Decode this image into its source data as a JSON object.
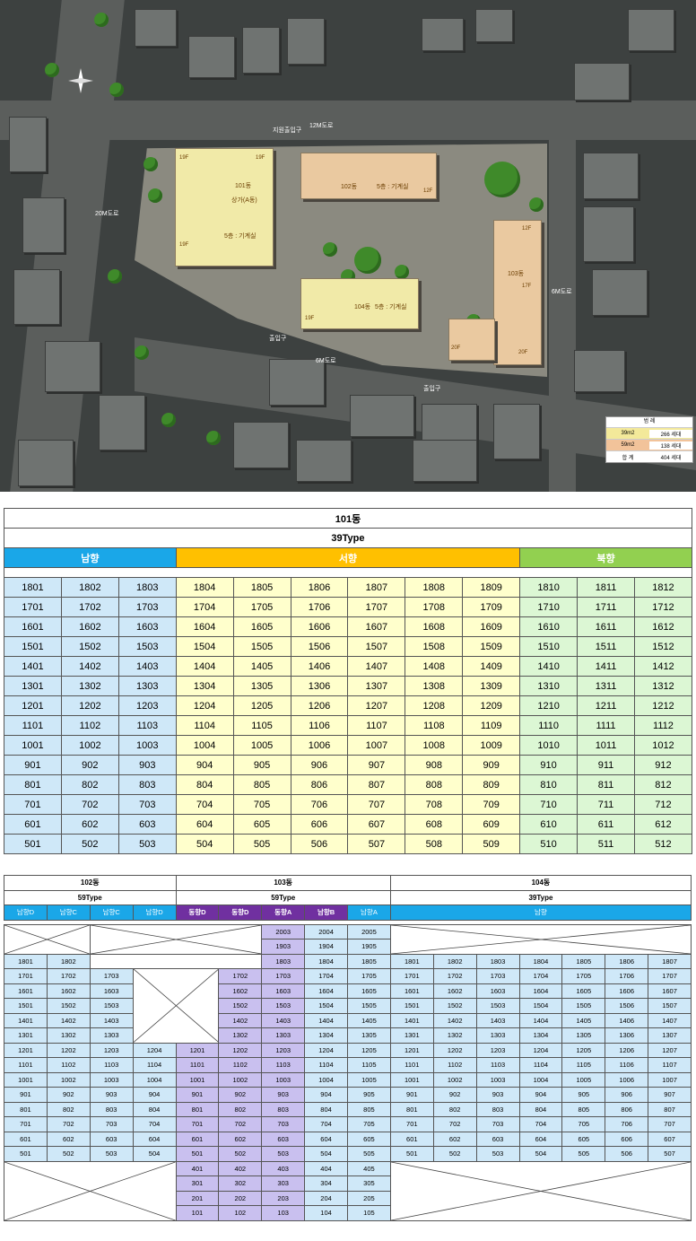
{
  "sitemap": {
    "labels": {
      "road_12m": "12M도로",
      "road_20m": "20M도로",
      "road_6m_east": "6M도로",
      "road_6m_south": "6M도로",
      "entrance_parking": "지원출입구",
      "entrance_1": "출입구",
      "entrance_2": "출입구",
      "bldg_101": "101동",
      "bldg_102": "102동",
      "bldg_103": "103동",
      "bldg_104": "104동",
      "shop": "상가(A동)",
      "floor_5_mech_101": "5층 : 기계실",
      "floor_5_mech_102": "5층 : 기계실",
      "floor_5_mech_104": "5층 : 기계실",
      "floor_19f": "19F",
      "floor_12f": "12F",
      "floor_17f": "17F",
      "floor_20f": "20F"
    },
    "legend": {
      "title": "범 례",
      "rows": [
        {
          "type": "39m2",
          "count": "266 세대",
          "color": "#f3e99a"
        },
        {
          "type": "59m2",
          "count": "138 세대",
          "color": "#f2c39a"
        }
      ],
      "total_label": "합 계",
      "total_count": "404 세대"
    }
  },
  "table101": {
    "title": "101동",
    "type": "39Type",
    "headers": [
      "남향",
      "서향",
      "북향"
    ],
    "header_colors": [
      "#1aa7e8",
      "#ffc000",
      "#92d050"
    ],
    "rows": [
      [
        "1801",
        "1802",
        "1803",
        "1804",
        "1805",
        "1806",
        "1807",
        "1808",
        "1809",
        "1810",
        "1811",
        "1812"
      ],
      [
        "1701",
        "1702",
        "1703",
        "1704",
        "1705",
        "1706",
        "1707",
        "1708",
        "1709",
        "1710",
        "1711",
        "1712"
      ],
      [
        "1601",
        "1602",
        "1603",
        "1604",
        "1605",
        "1606",
        "1607",
        "1608",
        "1609",
        "1610",
        "1611",
        "1612"
      ],
      [
        "1501",
        "1502",
        "1503",
        "1504",
        "1505",
        "1506",
        "1507",
        "1508",
        "1509",
        "1510",
        "1511",
        "1512"
      ],
      [
        "1401",
        "1402",
        "1403",
        "1404",
        "1405",
        "1406",
        "1407",
        "1408",
        "1409",
        "1410",
        "1411",
        "1412"
      ],
      [
        "1301",
        "1302",
        "1303",
        "1304",
        "1305",
        "1306",
        "1307",
        "1308",
        "1309",
        "1310",
        "1311",
        "1312"
      ],
      [
        "1201",
        "1202",
        "1203",
        "1204",
        "1205",
        "1206",
        "1207",
        "1208",
        "1209",
        "1210",
        "1211",
        "1212"
      ],
      [
        "1101",
        "1102",
        "1103",
        "1104",
        "1105",
        "1106",
        "1107",
        "1108",
        "1109",
        "1110",
        "1111",
        "1112"
      ],
      [
        "1001",
        "1002",
        "1003",
        "1004",
        "1005",
        "1006",
        "1007",
        "1008",
        "1009",
        "1010",
        "1011",
        "1012"
      ],
      [
        "901",
        "902",
        "903",
        "904",
        "905",
        "906",
        "907",
        "908",
        "909",
        "910",
        "911",
        "912"
      ],
      [
        "801",
        "802",
        "803",
        "804",
        "805",
        "806",
        "807",
        "808",
        "809",
        "810",
        "811",
        "812"
      ],
      [
        "701",
        "702",
        "703",
        "704",
        "705",
        "706",
        "707",
        "708",
        "709",
        "710",
        "711",
        "712"
      ],
      [
        "601",
        "602",
        "603",
        "604",
        "605",
        "606",
        "607",
        "608",
        "609",
        "610",
        "611",
        "612"
      ],
      [
        "501",
        "502",
        "503",
        "504",
        "505",
        "506",
        "507",
        "508",
        "509",
        "510",
        "511",
        "512"
      ]
    ]
  },
  "table2": {
    "bldg102": {
      "title": "102동",
      "type": "59Type"
    },
    "bldg103": {
      "title": "103동",
      "type": "59Type"
    },
    "bldg104": {
      "title": "104동",
      "type": "39Type"
    },
    "col_headers": [
      "남향D",
      "남향C",
      "남향C",
      "남향D",
      "동향D",
      "동향D",
      "동향A",
      "남향B",
      "남향A"
    ],
    "header_104": "남향",
    "rows": [
      {
        "c": [
          null,
          null,
          null,
          null,
          null,
          null,
          "2003",
          "2004",
          "2005"
        ],
        "r104": null
      },
      {
        "c": [
          null,
          null,
          null,
          null,
          null,
          null,
          "1903",
          "1904",
          "1905"
        ],
        "r104": null
      },
      {
        "c": [
          "1801",
          "1802",
          null,
          null,
          null,
          null,
          "1803",
          "1804",
          "1805"
        ],
        "r104": [
          "1801",
          "1802",
          "1803",
          "1804",
          "1805",
          "1806",
          "1807"
        ]
      },
      {
        "c": [
          "1701",
          "1702",
          "1703",
          null,
          null,
          "1702",
          "1703",
          "1704",
          "1705"
        ],
        "r104": [
          "1701",
          "1702",
          "1703",
          "1704",
          "1705",
          "1706",
          "1707"
        ]
      },
      {
        "c": [
          "1601",
          "1602",
          "1603",
          null,
          null,
          "1602",
          "1603",
          "1604",
          "1605"
        ],
        "r104": [
          "1601",
          "1602",
          "1603",
          "1604",
          "1605",
          "1606",
          "1607"
        ]
      },
      {
        "c": [
          "1501",
          "1502",
          "1503",
          null,
          null,
          "1502",
          "1503",
          "1504",
          "1505"
        ],
        "r104": [
          "1501",
          "1502",
          "1503",
          "1504",
          "1505",
          "1506",
          "1507"
        ]
      },
      {
        "c": [
          "1401",
          "1402",
          "1403",
          null,
          null,
          "1402",
          "1403",
          "1404",
          "1405"
        ],
        "r104": [
          "1401",
          "1402",
          "1403",
          "1404",
          "1405",
          "1406",
          "1407"
        ]
      },
      {
        "c": [
          "1301",
          "1302",
          "1303",
          null,
          null,
          "1302",
          "1303",
          "1304",
          "1305"
        ],
        "r104": [
          "1301",
          "1302",
          "1303",
          "1304",
          "1305",
          "1306",
          "1307"
        ]
      },
      {
        "c": [
          "1201",
          "1202",
          "1203",
          "1204",
          "1201",
          "1202",
          "1203",
          "1204",
          "1205"
        ],
        "r104": [
          "1201",
          "1202",
          "1203",
          "1204",
          "1205",
          "1206",
          "1207"
        ]
      },
      {
        "c": [
          "1101",
          "1102",
          "1103",
          "1104",
          "1101",
          "1102",
          "1103",
          "1104",
          "1105"
        ],
        "r104": [
          "1101",
          "1102",
          "1103",
          "1104",
          "1105",
          "1106",
          "1107"
        ]
      },
      {
        "c": [
          "1001",
          "1002",
          "1003",
          "1004",
          "1001",
          "1002",
          "1003",
          "1004",
          "1005"
        ],
        "r104": [
          "1001",
          "1002",
          "1003",
          "1004",
          "1005",
          "1006",
          "1007"
        ]
      },
      {
        "c": [
          "901",
          "902",
          "903",
          "904",
          "901",
          "902",
          "903",
          "904",
          "905"
        ],
        "r104": [
          "901",
          "902",
          "903",
          "904",
          "905",
          "906",
          "907"
        ]
      },
      {
        "c": [
          "801",
          "802",
          "803",
          "804",
          "801",
          "802",
          "803",
          "804",
          "805"
        ],
        "r104": [
          "801",
          "802",
          "803",
          "804",
          "805",
          "806",
          "807"
        ]
      },
      {
        "c": [
          "701",
          "702",
          "703",
          "704",
          "701",
          "702",
          "703",
          "704",
          "705"
        ],
        "r104": [
          "701",
          "702",
          "703",
          "704",
          "705",
          "706",
          "707"
        ]
      },
      {
        "c": [
          "601",
          "602",
          "603",
          "604",
          "601",
          "602",
          "603",
          "604",
          "605"
        ],
        "r104": [
          "601",
          "602",
          "603",
          "604",
          "605",
          "606",
          "607"
        ]
      },
      {
        "c": [
          "501",
          "502",
          "503",
          "504",
          "501",
          "502",
          "503",
          "504",
          "505"
        ],
        "r104": [
          "501",
          "502",
          "503",
          "504",
          "505",
          "506",
          "507"
        ]
      },
      {
        "c": [
          null,
          null,
          null,
          null,
          "401",
          "402",
          "403",
          "404",
          "405"
        ],
        "r104": null
      },
      {
        "c": [
          null,
          null,
          null,
          null,
          "301",
          "302",
          "303",
          "304",
          "305"
        ],
        "r104": null
      },
      {
        "c": [
          null,
          null,
          null,
          null,
          "201",
          "202",
          "203",
          "204",
          "205"
        ],
        "r104": null
      },
      {
        "c": [
          null,
          null,
          null,
          null,
          "101",
          "102",
          "103",
          "104",
          "105"
        ],
        "r104": null
      }
    ]
  }
}
